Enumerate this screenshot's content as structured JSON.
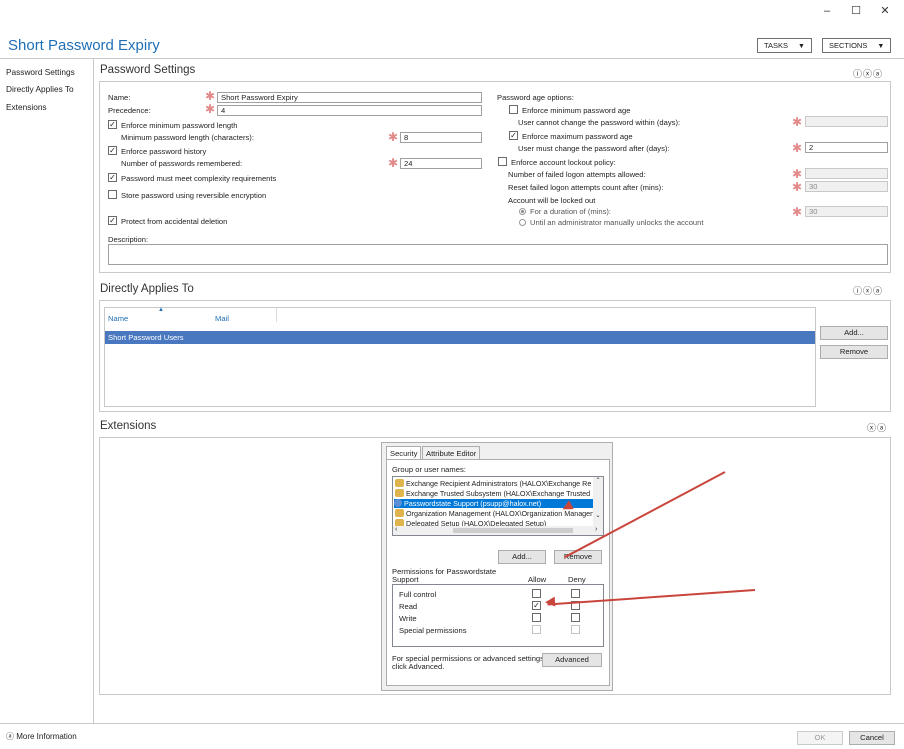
{
  "window": {
    "minimize": "–",
    "maximize": "☐",
    "close": "✕",
    "title": "Short Password Expiry",
    "tasks_label": "TASKS",
    "sections_label": "SECTIONS"
  },
  "nav": {
    "items": [
      "Password Settings",
      "Directly Applies To",
      "Extensions"
    ],
    "more_info": "More Information"
  },
  "password_settings": {
    "heading": "Password Settings",
    "name_label": "Name:",
    "name_value": "Short Password Expiry",
    "precedence_label": "Precedence:",
    "precedence_value": "4",
    "enforce_min_length_label": "Enforce minimum password length",
    "min_length_label": "Minimum password length (characters):",
    "min_length_value": "8",
    "enforce_history_label": "Enforce password history",
    "history_label": "Number of passwords remembered:",
    "history_value": "24",
    "complexity_label": "Password must meet complexity requirements",
    "reversible_label": "Store password using reversible encryption",
    "protect_label": "Protect from accidental deletion",
    "description_label": "Description:",
    "age_options_label": "Password age options:",
    "enforce_min_age_label": "Enforce minimum password age",
    "min_age_sub_label": "User cannot change the password within (days):",
    "enforce_max_age_label": "Enforce maximum password age",
    "max_age_sub_label": "User must change the password after (days):",
    "max_age_value": "2",
    "lockout_label": "Enforce account lockout policy:",
    "failed_attempts_label": "Number of failed logon attempts allowed:",
    "reset_count_label": "Reset failed logon attempts count after (mins):",
    "reset_count_value": "30",
    "locked_out_label": "Account will be locked out",
    "duration_label": "For a duration of (mins):",
    "duration_value": "30",
    "until_admin_label": "Until an administrator manually unlocks the account",
    "checked": {
      "enforce_min_length": true,
      "enforce_history": true,
      "complexity": true,
      "reversible": false,
      "protect": true,
      "min_age": false,
      "max_age": true,
      "lockout": false
    }
  },
  "applies_to": {
    "heading": "Directly Applies To",
    "col_name": "Name",
    "col_mail": "Mail",
    "rows": [
      "Short Password Users"
    ],
    "add_label": "Add...",
    "remove_label": "Remove"
  },
  "extensions": {
    "heading": "Extensions",
    "tabs": [
      "Security",
      "Attribute Editor"
    ],
    "group_label": "Group or user names:",
    "principals": [
      "Exchange Recipient Administrators (HALOX\\Exchange Re",
      "Exchange Trusted Subsystem (HALOX\\Exchange Trusted",
      "Passwordstate Support (psupp@halox.net)",
      "Organization Management (HALOX\\Organization Managen",
      "Delegated Setup (HALOX\\Delegated Setup)"
    ],
    "add_label": "Add...",
    "remove_label": "Remove",
    "perm_title_1": "Permissions for Passwordstate",
    "perm_title_2": "Support",
    "allow_label": "Allow",
    "deny_label": "Deny",
    "permissions": [
      {
        "name": "Full control",
        "allow": false,
        "deny": false
      },
      {
        "name": "Read",
        "allow": true,
        "deny": false
      },
      {
        "name": "Write",
        "allow": false,
        "deny": false
      },
      {
        "name": "Special permissions",
        "allow": false,
        "deny": false
      }
    ],
    "advanced_note_1": "For special permissions or advanced settings,",
    "advanced_note_2": "click Advanced.",
    "advanced_label": "Advanced"
  },
  "footer": {
    "ok_label": "OK",
    "cancel_label": "Cancel"
  },
  "icons": {
    "help": "?",
    "close": "✕",
    "collapse": "⌃"
  }
}
